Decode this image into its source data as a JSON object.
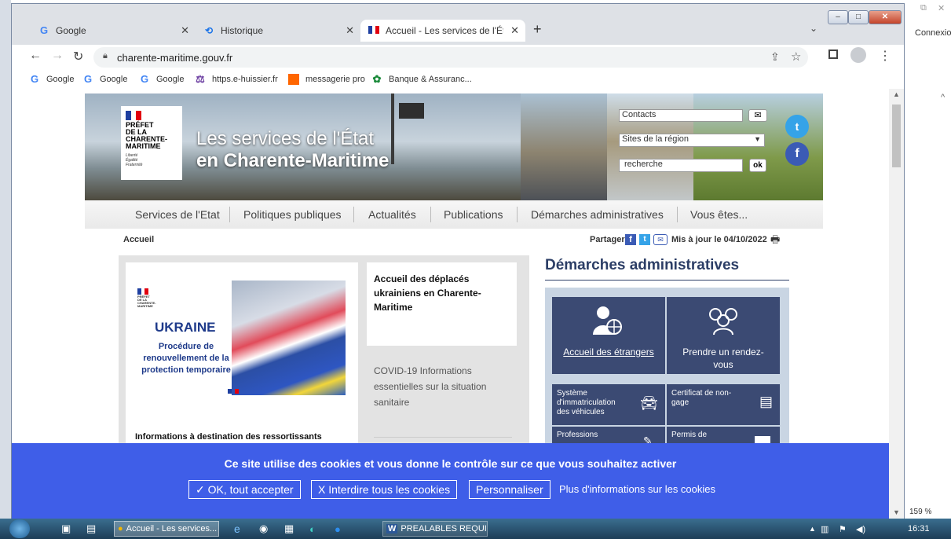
{
  "browser": {
    "tabs": [
      {
        "label": "Google"
      },
      {
        "label": "Historique"
      },
      {
        "label": "Accueil - Les services de l'État en"
      }
    ],
    "url": "charente-maritime.gouv.fr",
    "bookmarks": [
      "Google",
      "Google",
      "Google",
      "https.e-huissier.fr",
      "messagerie pro",
      "Banque & Assuranc..."
    ]
  },
  "background": {
    "connexion": "Connexio"
  },
  "banner": {
    "logo_lines": [
      "PRÉFET",
      "DE LA",
      "CHARENTE-",
      "MARITIME"
    ],
    "motto": [
      "Liberté",
      "Égalité",
      "Fraternité"
    ],
    "title_line1": "Les services de l'État",
    "title_line2": "en Charente-Maritime",
    "contacts_placeholder": "Contacts",
    "sites_select": "Sites de la région",
    "search_placeholder": "recherche",
    "search_button": "ok"
  },
  "nav": [
    "Services de l'Etat",
    "Politiques publiques",
    "Actualités",
    "Publications",
    "Démarches administratives",
    "Vous êtes..."
  ],
  "breadcrumb": "Accueil",
  "share": {
    "label": "Partager",
    "updated": "Mis à jour le 04/10/2022"
  },
  "ukraine_card": {
    "prefet_lines": [
      "PRÉFET",
      "DE LA",
      "CHARENTE-",
      "MARITIME"
    ],
    "heading": "UKRAINE",
    "subtitle_lines": [
      "Procédure de",
      "renouvellement de la",
      "protection temporaire"
    ],
    "caption": "Informations à destination des ressortissants"
  },
  "news": [
    {
      "title": "Accueil des déplacés ukrainiens en Charente-Maritime"
    },
    {
      "title": "COVID-19 Informations essentielles sur la situation sanitaire"
    }
  ],
  "demarches": {
    "heading": "Démarches administratives",
    "big": [
      {
        "label": "Accueil des étrangers",
        "icon": "person-globe-icon"
      },
      {
        "label": "Prendre un rendez-vous",
        "icon": "people-icon"
      }
    ],
    "small": [
      {
        "label": "Système d'immatriculation des véhicules",
        "icon": "car-icon"
      },
      {
        "label": "Certificat de non-gage",
        "icon": "certificate-icon"
      },
      {
        "label": "Professions",
        "icon": "pen-icon"
      },
      {
        "label": "Permis de",
        "icon": "card-icon"
      }
    ]
  },
  "cookie": {
    "message": "Ce site utilise des cookies et vous donne le contrôle sur ce que vous souhaitez activer",
    "accept": "✓ OK, tout accepter",
    "deny": "X Interdire tous les cookies",
    "custom": "Personnaliser",
    "more": "Plus d'informations sur les cookies"
  },
  "taskbar": {
    "items": [
      "Accueil - Les services...",
      "PREALABLES REQUIS..."
    ],
    "time": "16:31",
    "zoom": "159 %"
  },
  "colors": {
    "cookie": "#3f5ee8",
    "demarches": "#3b4a73",
    "heading": "#2c3e66",
    "twitter": "#35a3e8"
  }
}
